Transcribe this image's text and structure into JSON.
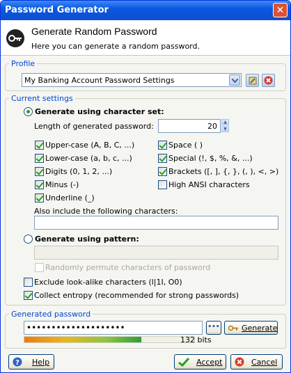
{
  "window": {
    "title": "Password Generator",
    "close_glyph": "✕"
  },
  "banner": {
    "heading": "Generate Random Password",
    "subtitle": "Here you can generate a random password.",
    "icon": "key-icon"
  },
  "profile": {
    "legend": "Profile",
    "selected": "My Banking Account Password Settings"
  },
  "settings": {
    "legend": "Current settings",
    "charset_label": "Generate using character set:",
    "length_label": "Length of generated password:",
    "length_value": "20",
    "checkboxes": [
      {
        "label": "Upper-case (A, B, C, ...)",
        "checked": true
      },
      {
        "label": "Space ( )",
        "checked": true
      },
      {
        "label": "Lower-case (a, b, c, ...)",
        "checked": true
      },
      {
        "label": "Special (!, $, %, &, ...)",
        "checked": true
      },
      {
        "label": "Digits (0, 1, 2, ...)",
        "checked": true
      },
      {
        "label": "Brackets ([, ], {, }, (, ), <, >)",
        "checked": true
      },
      {
        "label": "Minus (-)",
        "checked": true
      },
      {
        "label": "High ANSI characters",
        "checked": false
      },
      {
        "label": "Underline (_)",
        "checked": true
      }
    ],
    "also_include_label": "Also include the following characters:",
    "also_include_value": "",
    "pattern_label": "Generate using pattern:",
    "pattern_value": "",
    "permute_label": "Randomly permute characters of password",
    "exclude_label": "Exclude look-alike characters (l|1I, O0)",
    "exclude_checked": false,
    "entropy_label": "Collect entropy (recommended for strong passwords)",
    "entropy_checked": true
  },
  "generated": {
    "legend": "Generated password",
    "value": "••••••••••••••••••••",
    "toggle_label": "•••",
    "generate_label": "Generate",
    "strength_bits": "132 bits",
    "strength_fraction": 0.69
  },
  "footer": {
    "help_label": "Help",
    "accept_label": "Accept",
    "cancel_label": "Cancel"
  },
  "colors": {
    "title_blue": "#0b58e0",
    "legend_blue": "#0046d5",
    "check_green": "#21a121",
    "close_red": "#d9533a"
  }
}
